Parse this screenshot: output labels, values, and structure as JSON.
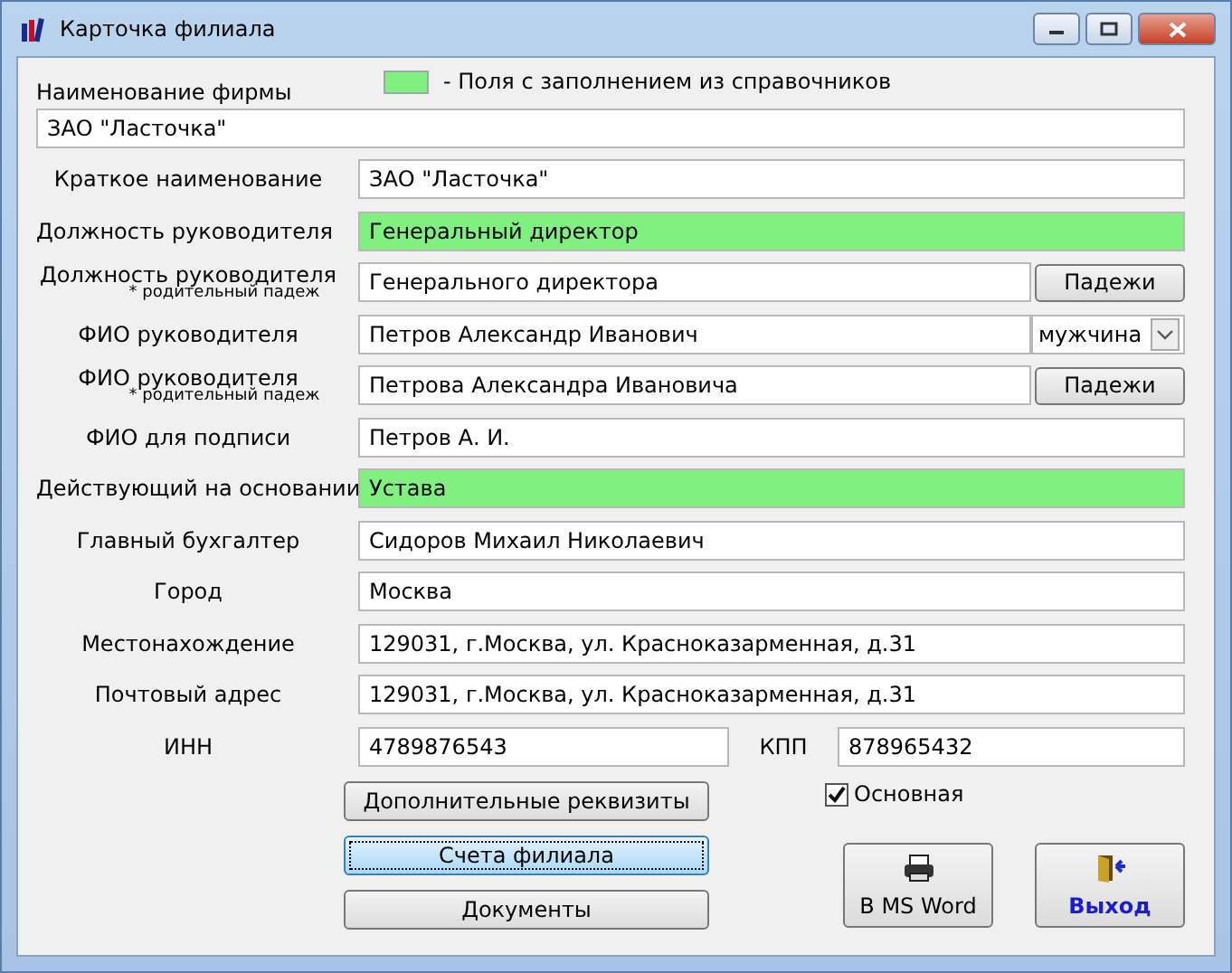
{
  "window": {
    "title": "Карточка филиала"
  },
  "legend": {
    "text": "-  Поля с заполнением из справочников"
  },
  "firm": {
    "label": "Наименование фирмы",
    "value": "ЗАО \"Ласточка\""
  },
  "fields": [
    {
      "label": "Краткое наименование",
      "value": "ЗАО \"Ласточка\"",
      "from_directory": false
    },
    {
      "label": "Должность руководителя",
      "value": "Генеральный директор",
      "from_directory": true
    },
    {
      "label": "Должность руководителя",
      "sublabel": "* родительный падеж",
      "value": "Генерального директора",
      "from_directory": false,
      "button": "Падежи"
    },
    {
      "label": "ФИО руководителя",
      "value": "Петров Александр Иванович",
      "from_directory": false,
      "select": "мужчина"
    },
    {
      "label": "ФИО руководителя",
      "sublabel": "* родительный падеж",
      "value": "Петрова Александра Ивановича",
      "from_directory": false,
      "button": "Падежи"
    },
    {
      "label": "ФИО для подписи",
      "value": "Петров А. И.",
      "from_directory": false
    },
    {
      "label": "Действующий на основании",
      "value": "Устава",
      "from_directory": true
    },
    {
      "label": "Главный бухгалтер",
      "value": "Сидоров Михаил Николаевич",
      "from_directory": false
    },
    {
      "label": "Город",
      "value": "Москва",
      "from_directory": false
    },
    {
      "label": "Местонахождение",
      "value": "129031, г.Москва, ул. Красноказарменная, д.31",
      "from_directory": false
    },
    {
      "label": "Почтовый адрес",
      "value": "129031, г.Москва, ул. Красноказарменная, д.31",
      "from_directory": false
    }
  ],
  "inn": {
    "label": "ИНН",
    "value": "4789876543"
  },
  "kpp": {
    "label": "КПП",
    "value": "878965432"
  },
  "main_branch": {
    "label": "Основная",
    "checked": true
  },
  "left_buttons": [
    {
      "label": "Дополнительные реквизиты",
      "focused": false
    },
    {
      "label": "Счета филиала",
      "focused": true
    },
    {
      "label": "Документы",
      "focused": false
    }
  ],
  "actions": [
    {
      "kind": "print",
      "label": "В MS Word"
    },
    {
      "kind": "exit",
      "label": "Выход"
    }
  ]
}
